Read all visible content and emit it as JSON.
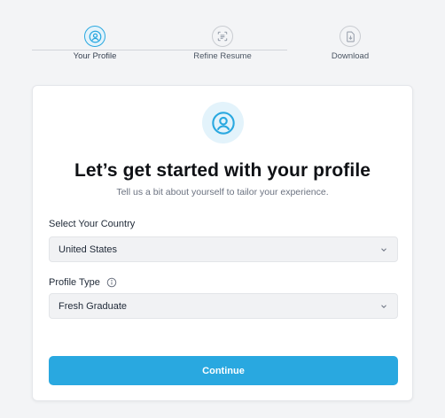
{
  "stepper": {
    "steps": [
      {
        "label": "Your Profile",
        "icon": "user-circle-icon",
        "active": true
      },
      {
        "label": "Refine Resume",
        "icon": "scan-document-icon",
        "active": false
      },
      {
        "label": "Download",
        "icon": "download-file-icon",
        "active": false
      }
    ]
  },
  "card": {
    "avatar_icon": "user-circle-icon",
    "title": "Let’s get started with your profile",
    "subtitle": "Tell us a bit about yourself to tailor your experience."
  },
  "form": {
    "country_label": "Select Your Country",
    "country_value": "United States",
    "profile_type_label": "Profile Type",
    "profile_type_value": "Fresh Graduate",
    "continue_label": "Continue"
  },
  "colors": {
    "accent": "#29a8e0",
    "accent_light": "#e3f3fb",
    "background": "#f3f4f6"
  }
}
